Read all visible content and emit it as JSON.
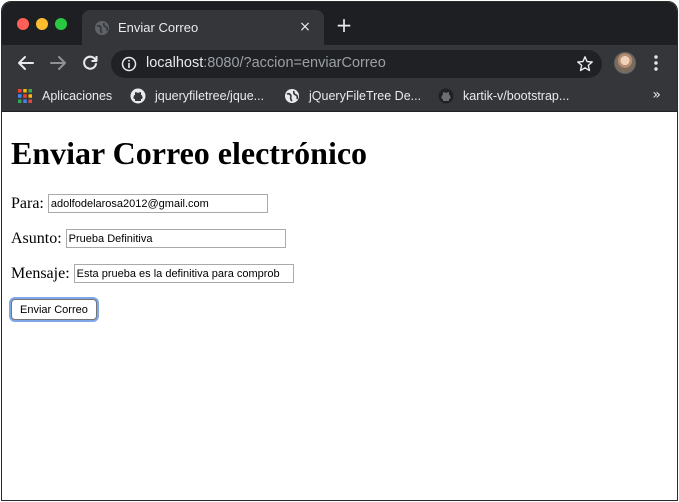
{
  "browser": {
    "tab": {
      "title": "Enviar Correo",
      "close_label": "×",
      "new_tab_label": "+"
    },
    "url": {
      "host": "localhost",
      "rest": ":8080/?accion=enviarCorreo"
    },
    "bookmarks": [
      {
        "label": "Aplicaciones",
        "icon": "apps-grid-icon"
      },
      {
        "label": "jqueryfiletree/jque...",
        "icon": "github-icon"
      },
      {
        "label": "jQueryFileTree De...",
        "icon": "globe-icon"
      },
      {
        "label": "kartik-v/bootstrap...",
        "icon": "github-icon"
      }
    ],
    "more_bookmarks": "»"
  },
  "page": {
    "heading": "Enviar Correo electrónico",
    "form": {
      "para_label": "Para:",
      "para_value": "adolfodelarosa2012@gmail.com",
      "asunto_label": "Asunto:",
      "asunto_value": "Prueba Definitiva",
      "mensaje_label": "Mensaje:",
      "mensaje_value": "Esta prueba es la definitiva para comprob",
      "submit_label": "Enviar Correo"
    }
  },
  "colors": {
    "titlebar": "#1e1f22",
    "toolbar": "#35363a",
    "focus_ring": "#7fa7e8"
  }
}
